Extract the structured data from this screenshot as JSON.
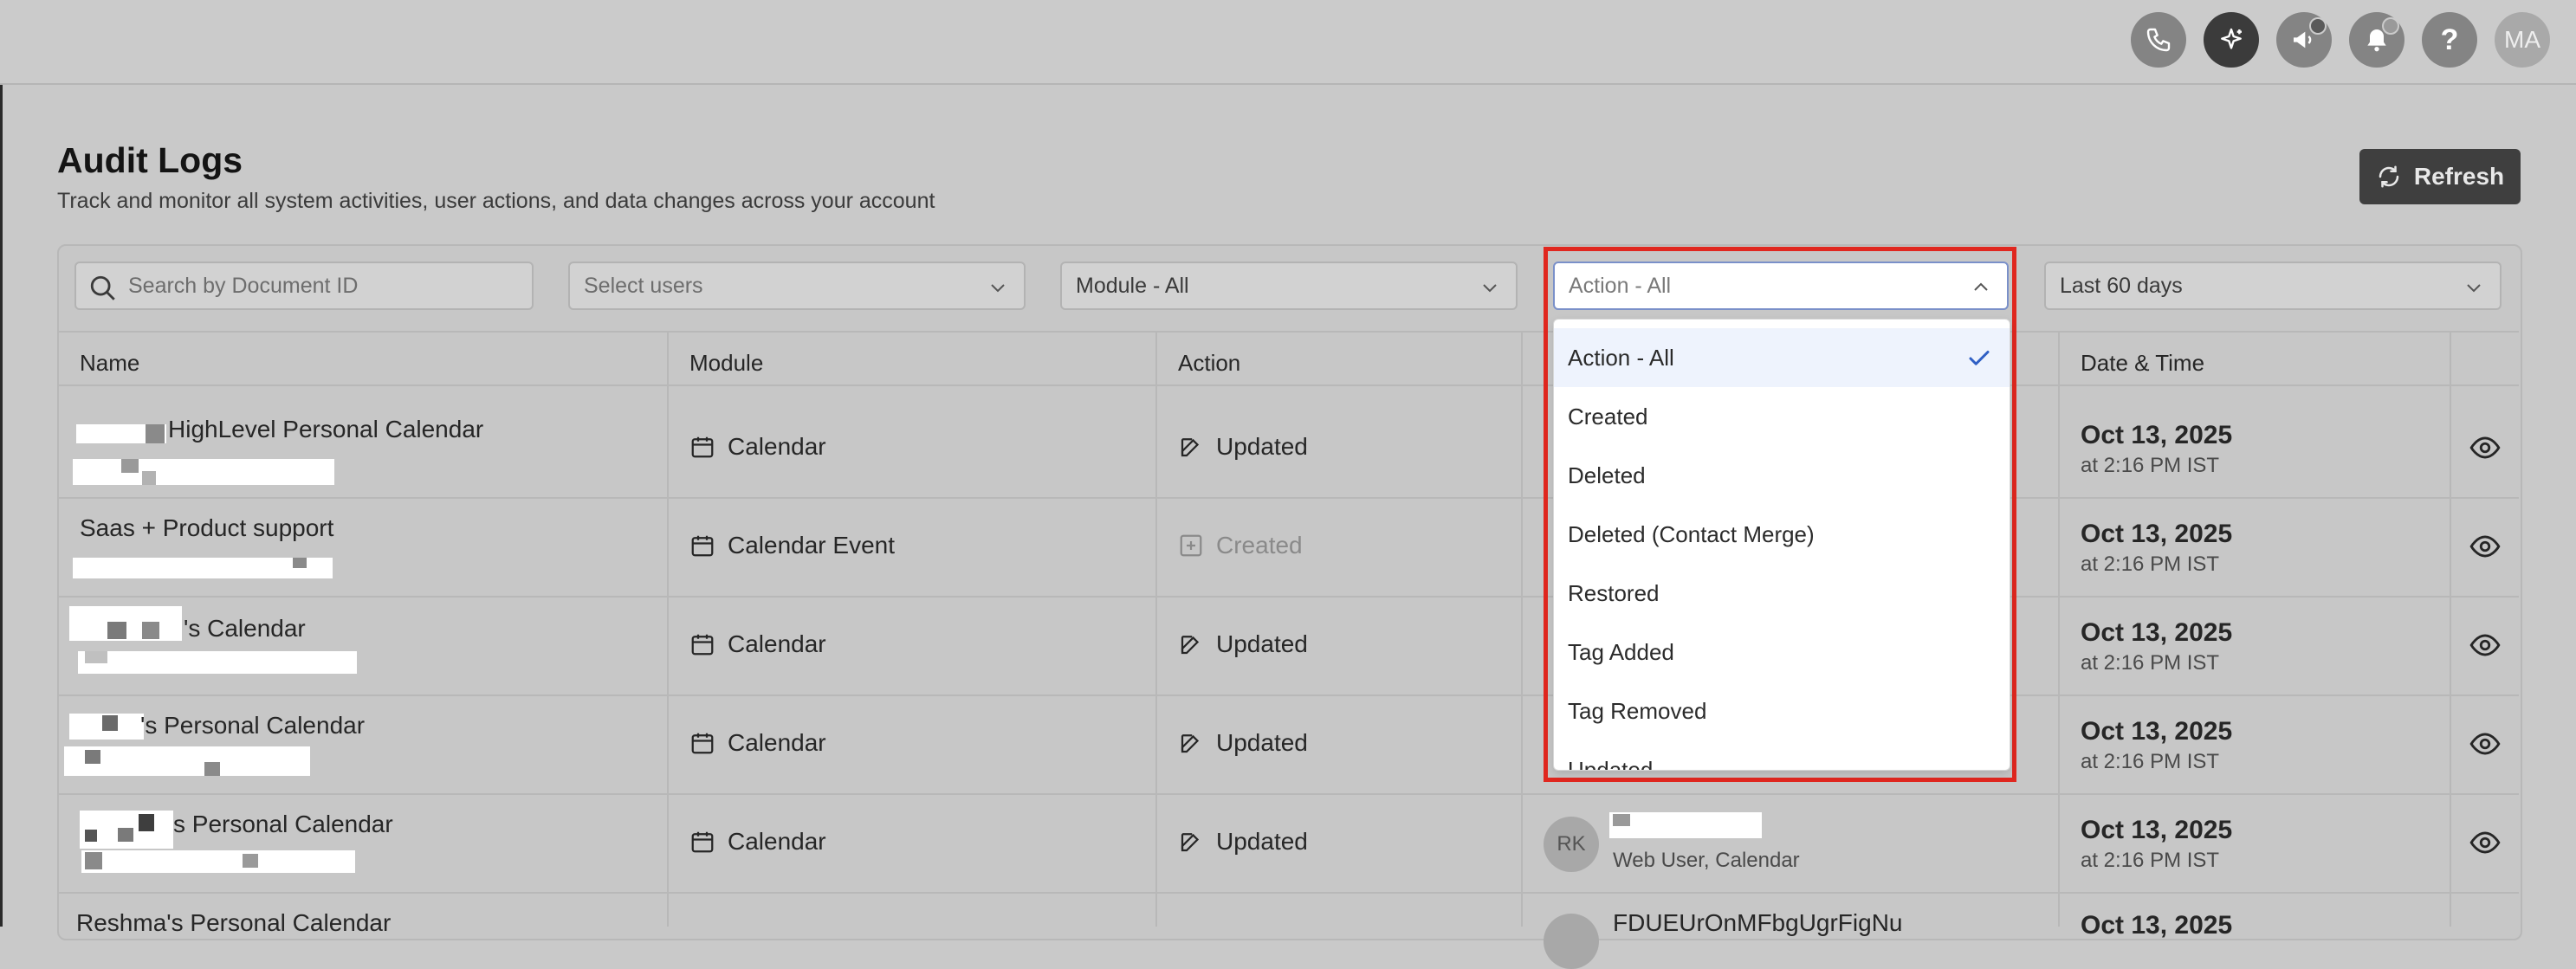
{
  "header": {
    "buttons": [
      {
        "name": "phone-icon"
      },
      {
        "name": "sparkle-icon"
      },
      {
        "name": "megaphone-icon"
      },
      {
        "name": "bell-icon"
      },
      {
        "name": "help-icon",
        "label": "?"
      },
      {
        "name": "avatar",
        "label": "MA"
      }
    ]
  },
  "page": {
    "title": "Audit Logs",
    "subtitle": "Track and monitor all system activities, user actions, and data changes across your account",
    "refresh_label": "Refresh"
  },
  "filters": {
    "search_placeholder": "Search by Document ID",
    "users_placeholder": "Select users",
    "module_value": "Module - All",
    "action_value": "Action - All",
    "date_value": "Last 60 days"
  },
  "columns": [
    "Name",
    "Module",
    "Action",
    "Date & Time"
  ],
  "rows": [
    {
      "name": "HighLevel Personal Calendar",
      "module": "Calendar",
      "action": "Updated",
      "date": "Oct 13, 2025",
      "time": "at 2:16 PM IST"
    },
    {
      "name": "Saas + Product support",
      "module": "Calendar Event",
      "action": "Created",
      "date": "Oct 13, 2025",
      "time": "at 2:16 PM IST"
    },
    {
      "name": "'s Calendar",
      "module": "Calendar",
      "action": "Updated",
      "date": "Oct 13, 2025",
      "time": "at 2:16 PM IST"
    },
    {
      "name": "'s Personal Calendar",
      "module": "Calendar",
      "action": "Updated",
      "date": "Oct 13, 2025",
      "time": "at 2:16 PM IST"
    },
    {
      "name": "s Personal Calendar",
      "module": "Calendar",
      "action": "Updated",
      "date": "Oct 13, 2025",
      "time": "at 2:16 PM IST",
      "user_initials": "RK",
      "user_meta": "Web User, Calendar"
    },
    {
      "name": "Reshma's Personal Calendar",
      "user_text": "FDUEUrOnMFbgUgrFigNu",
      "date": "Oct 13, 2025"
    }
  ],
  "dropdown": {
    "options": [
      "Action - All",
      "Created",
      "Deleted",
      "Deleted (Contact Merge)",
      "Restored",
      "Tag Added",
      "Tag Removed",
      "Updated"
    ],
    "selected": "Action - All"
  },
  "colors": {
    "highlight": "#e0271f",
    "selected_bg": "#eef3fd",
    "check": "#2f5fc4"
  }
}
